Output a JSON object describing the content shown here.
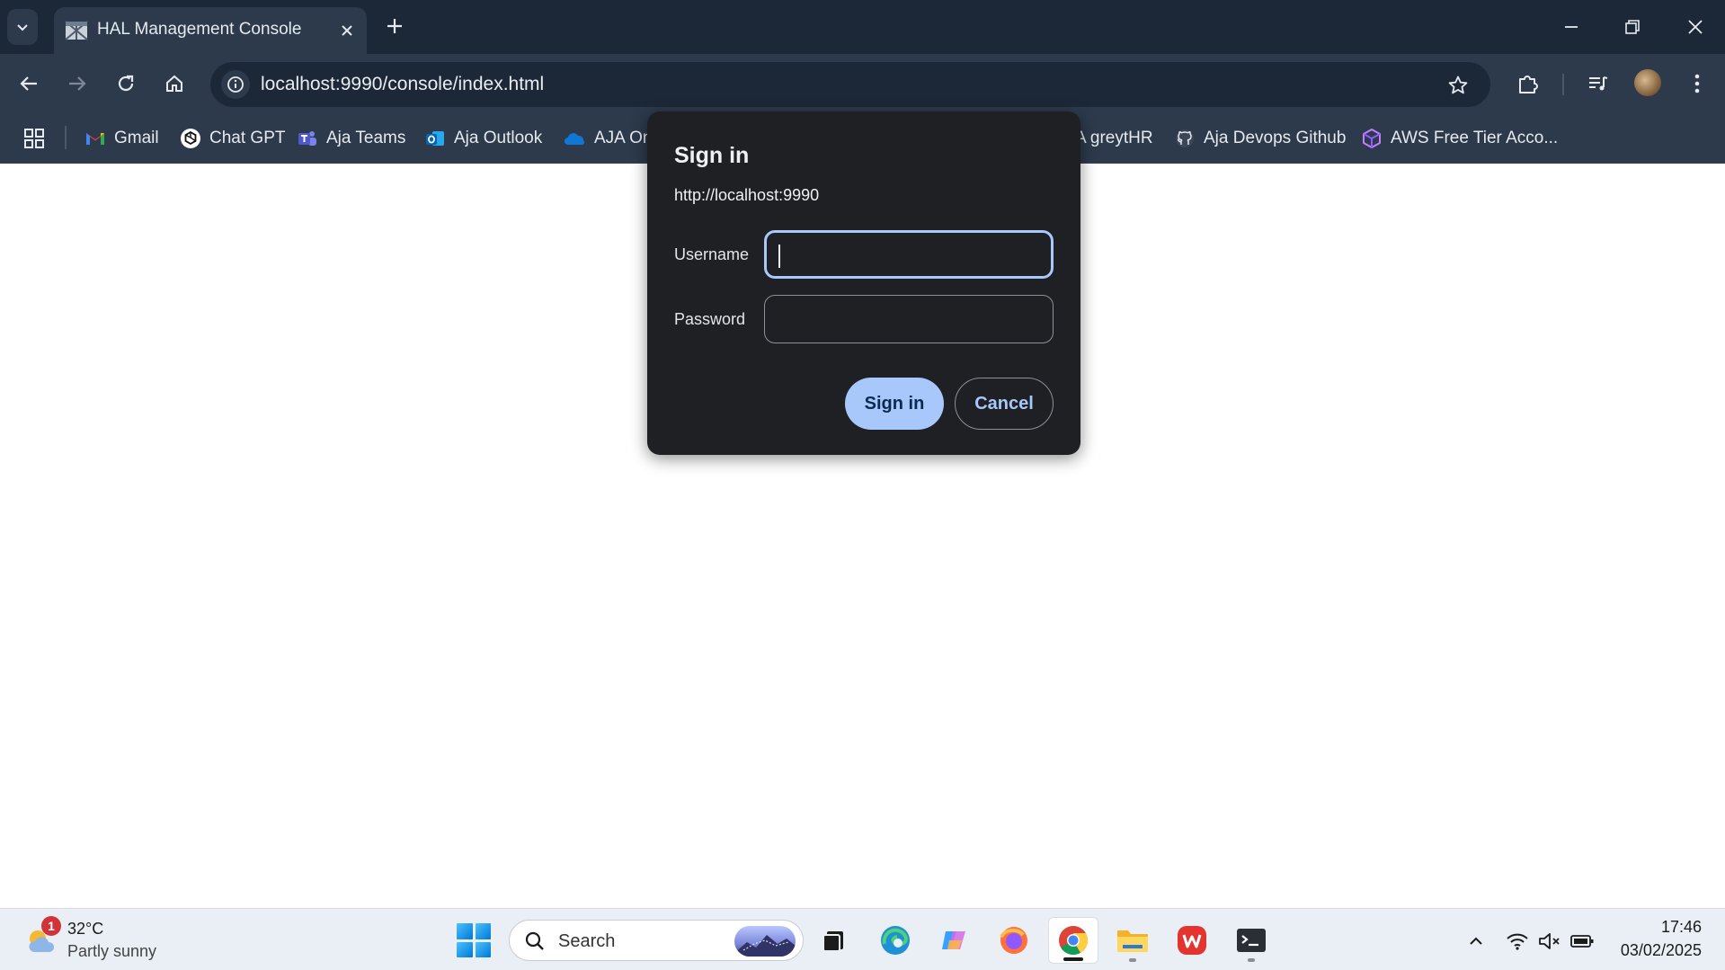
{
  "browser": {
    "tab": {
      "title": "HAL Management Console"
    },
    "address_bar": {
      "url": "localhost:9990/console/index.html"
    },
    "bookmarks": [
      {
        "label": "Gmail",
        "icon": "gmail-icon"
      },
      {
        "label": "Chat GPT",
        "icon": "chatgpt-icon"
      },
      {
        "label": "Aja Teams",
        "icon": "teams-icon"
      },
      {
        "label": "Aja Outlook",
        "icon": "outlook-icon"
      },
      {
        "label": "AJA On",
        "icon": "onedrive-icon"
      },
      {
        "label": "A greytHR",
        "icon": "none"
      },
      {
        "label": "Aja Devops Github",
        "icon": "github-icon"
      },
      {
        "label": "AWS Free Tier Acco...",
        "icon": "aws-cube-icon"
      }
    ]
  },
  "dialog": {
    "title": "Sign in",
    "origin": "http://localhost:9990",
    "username_label": "Username",
    "username_value": "",
    "password_label": "Password",
    "password_value": "",
    "sign_in_label": "Sign in",
    "cancel_label": "Cancel"
  },
  "taskbar": {
    "weather": {
      "badge": "1",
      "temperature": "32°C",
      "condition": "Partly sunny"
    },
    "search": {
      "placeholder": "Search"
    },
    "apps": [
      "task-view",
      "edge",
      "copilot",
      "firefox",
      "chrome",
      "file-explorer",
      "wps-office",
      "terminal"
    ],
    "active_app": "chrome",
    "clock": {
      "time": "17:46",
      "date": "03/02/2025"
    }
  },
  "colors": {
    "chrome_dark": "#1c2838",
    "chrome_toolbar": "#2c3a4c",
    "dialog_bg": "#1f2023",
    "accent": "#a8c7fa"
  }
}
